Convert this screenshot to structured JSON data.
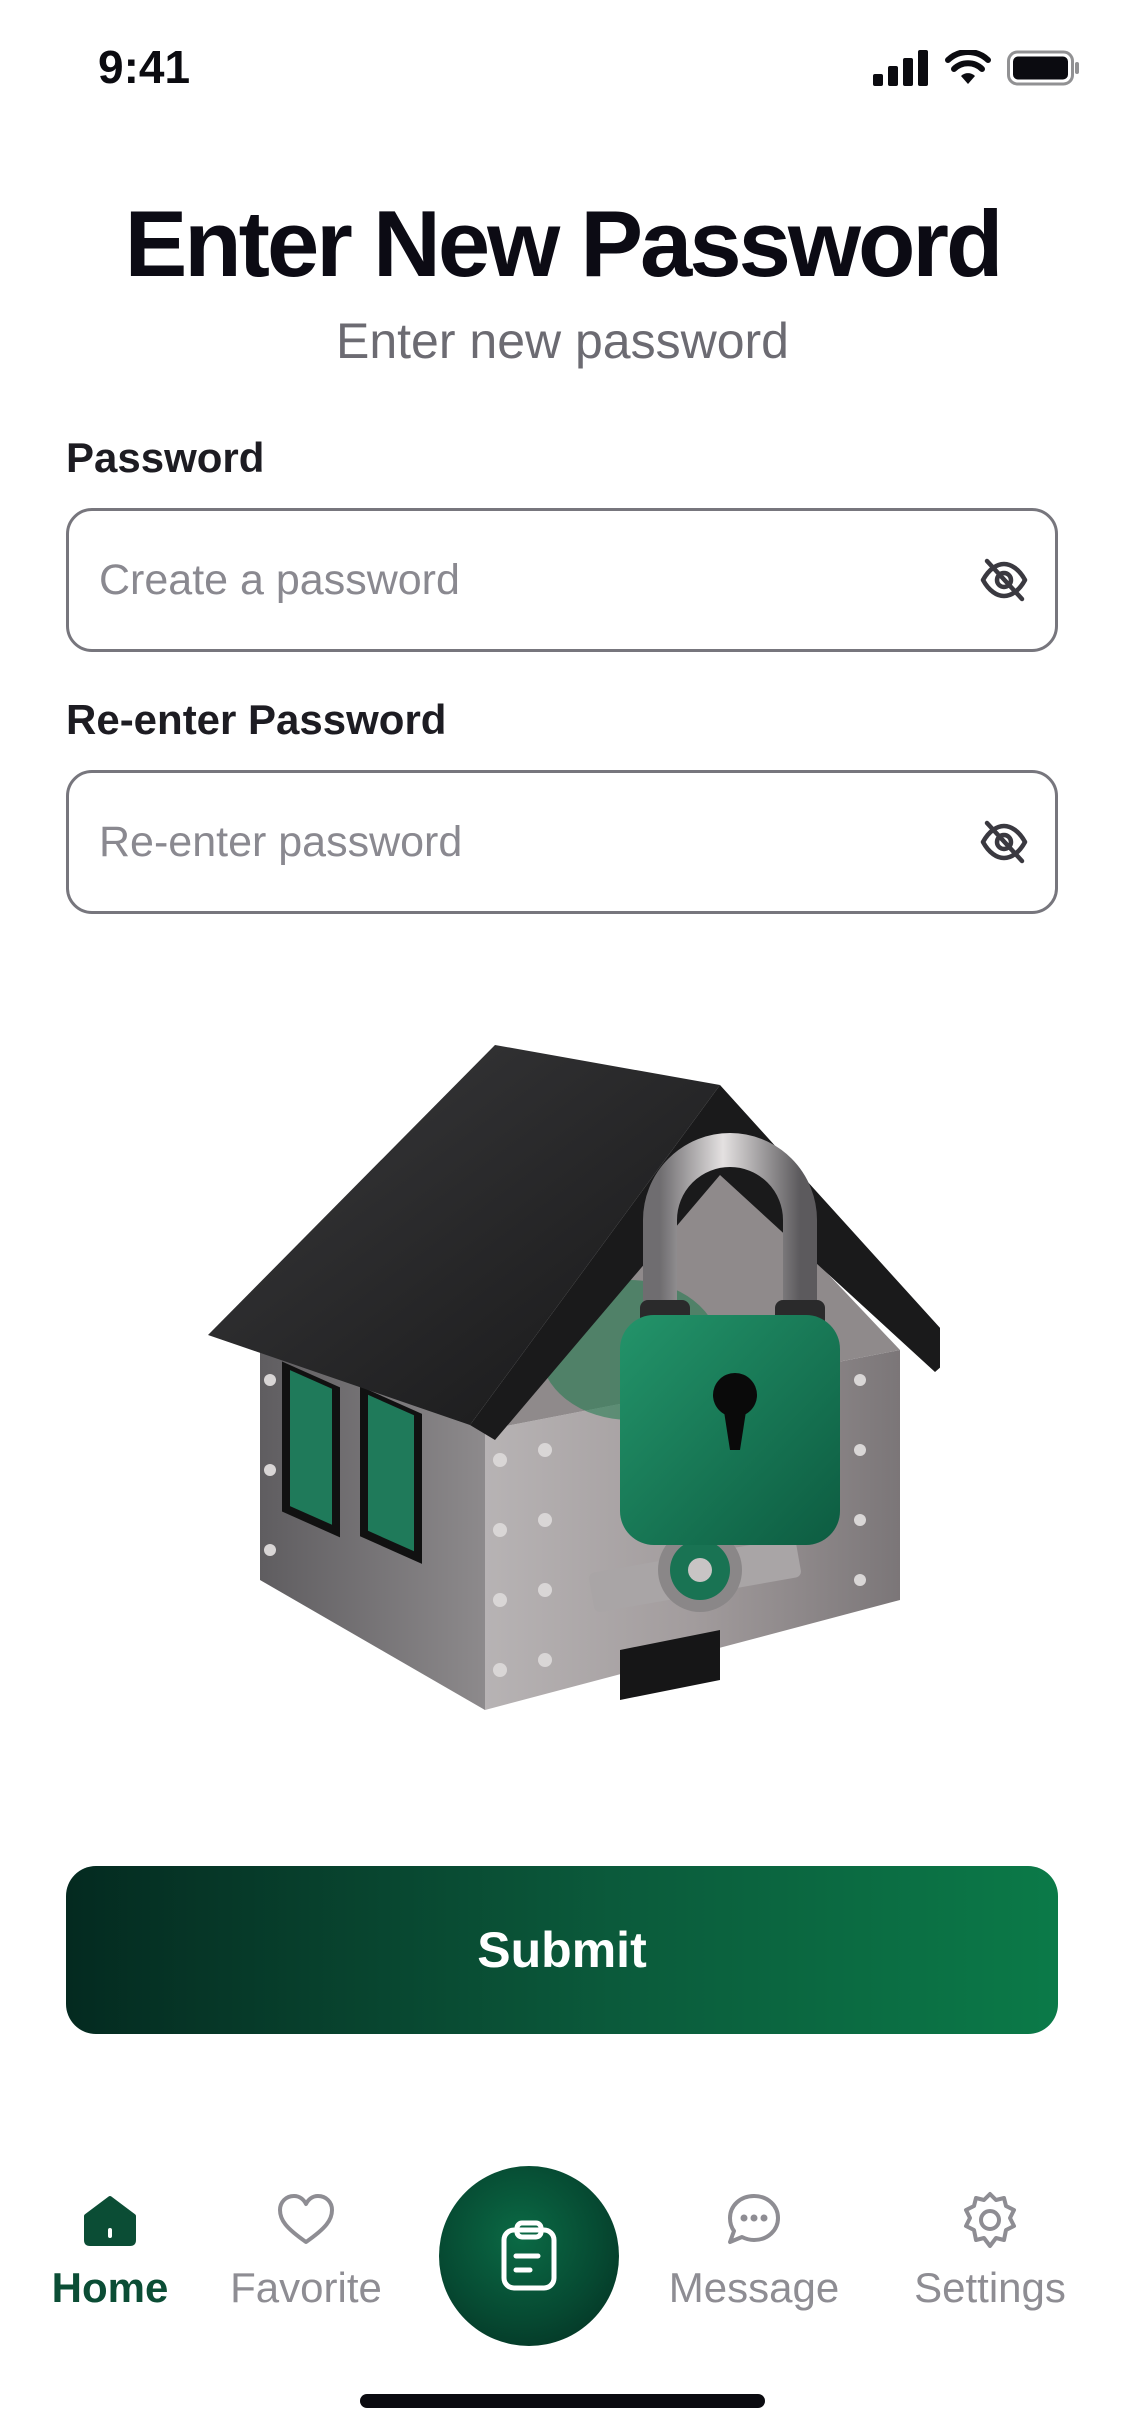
{
  "status_bar": {
    "time": "9:41"
  },
  "header": {
    "title": "Enter New Password",
    "subtitle": "Enter new password"
  },
  "form": {
    "password_label": "Password",
    "password_placeholder": "Create a password",
    "reenter_label": "Re-enter Password",
    "reenter_placeholder": "Re-enter password"
  },
  "submit_label": "Submit",
  "nav": {
    "items": [
      {
        "label": "Home",
        "icon": "home-icon",
        "active": true
      },
      {
        "label": "Favorite",
        "icon": "heart-icon",
        "active": false
      },
      {
        "label": "",
        "icon": "clipboard-icon",
        "active": false
      },
      {
        "label": "Message",
        "icon": "chat-bubble-icon",
        "active": false
      },
      {
        "label": "Settings",
        "icon": "gear-icon",
        "active": false
      }
    ]
  },
  "colors": {
    "accent": "#0b5a3b",
    "accent_dark": "#042a20",
    "accent_light": "#0b7a48",
    "text_primary": "#0c0b14",
    "text_muted": "#8e8d93"
  }
}
